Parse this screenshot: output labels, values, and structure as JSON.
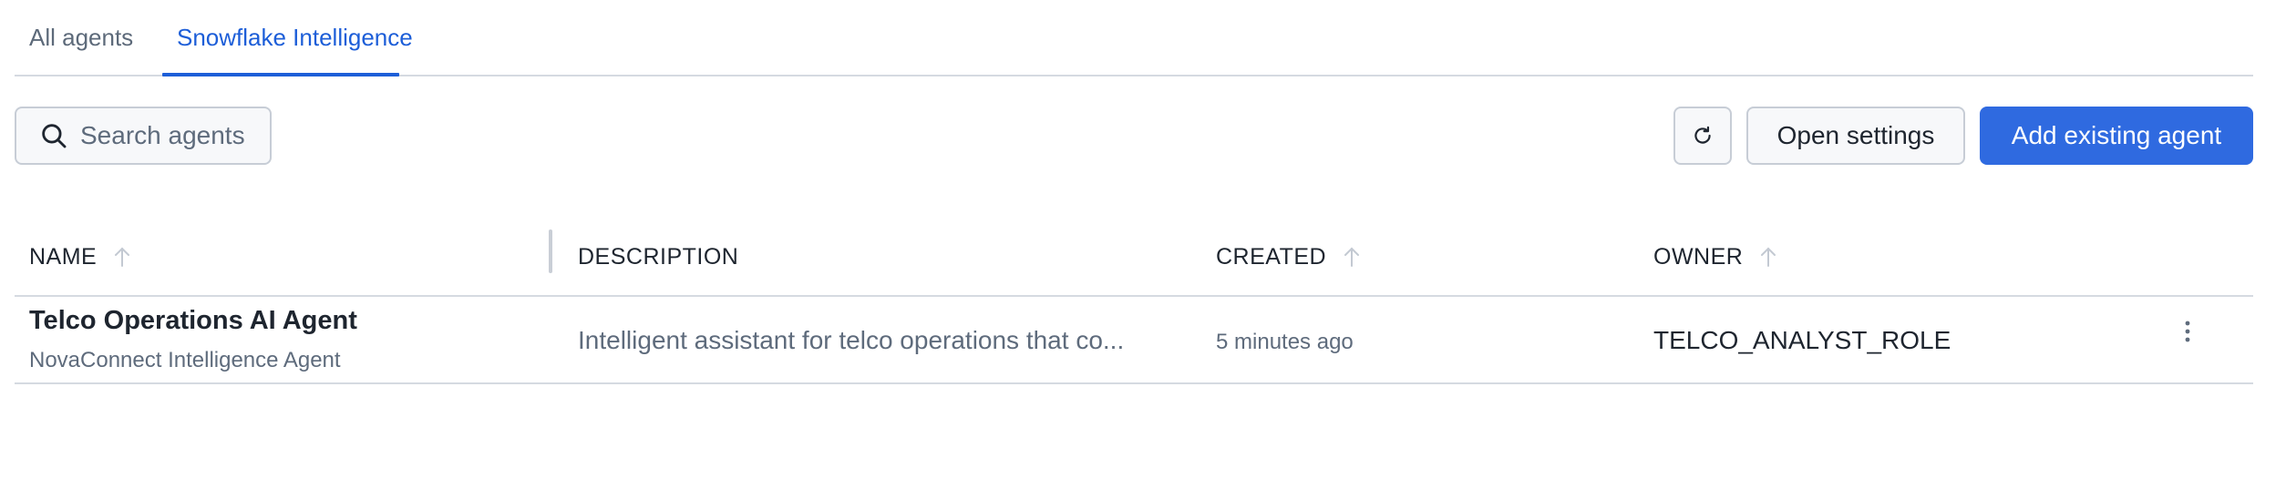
{
  "tabs": [
    {
      "label": "All agents",
      "active": false
    },
    {
      "label": "Snowflake Intelligence",
      "active": true
    }
  ],
  "toolbar": {
    "search_placeholder": "Search agents",
    "refresh_icon": "refresh-icon",
    "open_settings_label": "Open settings",
    "add_existing_agent_label": "Add existing agent"
  },
  "table": {
    "columns": [
      "NAME",
      "DESCRIPTION",
      "CREATED",
      "OWNER"
    ],
    "rows": [
      {
        "name": "Telco Operations AI Agent",
        "subtitle": "NovaConnect Intelligence Agent",
        "description": "Intelligent assistant for telco operations that co...",
        "created": "5 minutes ago",
        "owner": "TELCO_ANALYST_ROLE"
      }
    ]
  },
  "colors": {
    "accent": "#2f6ae0",
    "active_tab": "#1d5ed8",
    "border": "#d5dae1",
    "muted_text": "#5e6b7c"
  }
}
